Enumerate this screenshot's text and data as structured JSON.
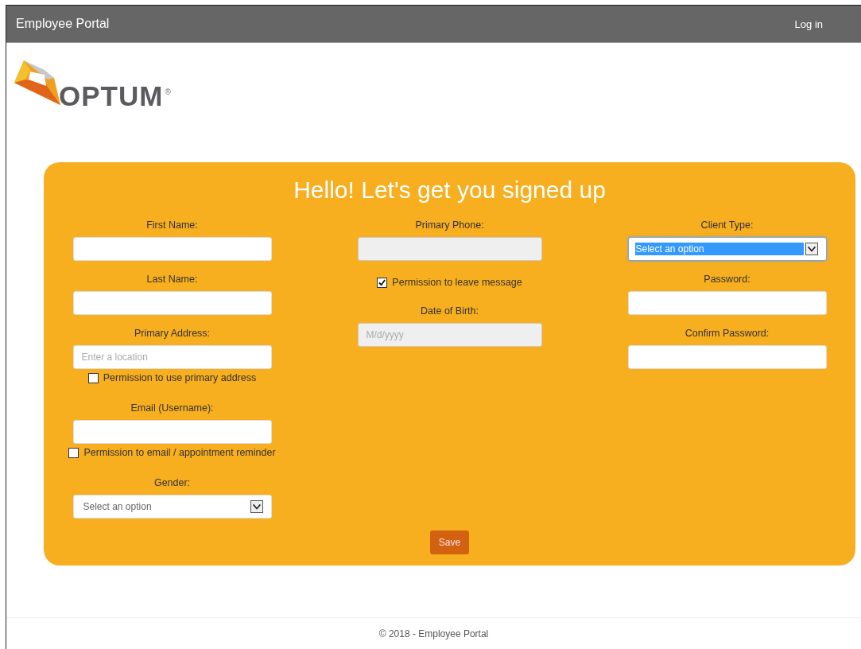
{
  "header": {
    "title": "Employee Portal",
    "login": "Log in"
  },
  "logo": {
    "wordmark": "OPTUM",
    "mark": "®"
  },
  "form": {
    "title": "Hello! Let's get you signed up",
    "columns": [
      [
        {
          "kind": "text",
          "label": "First Name:"
        },
        {
          "kind": "text",
          "label": "Last Name:"
        },
        {
          "kind": "text",
          "label": "Primary Address:",
          "placeholder": "Enter a location"
        },
        {
          "kind": "checkbox",
          "label": "Permission to use primary address",
          "checked": false
        },
        {
          "kind": "text",
          "label": "Email (Username):"
        },
        {
          "kind": "checkbox",
          "label": "Permission to email / appointment reminder",
          "checked": false
        },
        {
          "kind": "select",
          "label": "Gender:",
          "value": "Select an option",
          "focused": false
        }
      ],
      [
        {
          "kind": "text",
          "label": "Primary Phone:",
          "readonly": true
        },
        {
          "kind": "checkbox",
          "label": "Permission to leave message",
          "checked": true
        },
        {
          "kind": "text",
          "label": "Date of Birth:",
          "placeholder": "M/d/yyyy",
          "readonly": true
        }
      ],
      [
        {
          "kind": "select",
          "label": "Client Type:",
          "value": "Select an option",
          "focused": true
        },
        {
          "kind": "text",
          "label": "Password:"
        },
        {
          "kind": "text",
          "label": "Confirm Password:"
        }
      ]
    ],
    "save": "Save"
  },
  "footer": "© 2018 - Employee Portal"
}
